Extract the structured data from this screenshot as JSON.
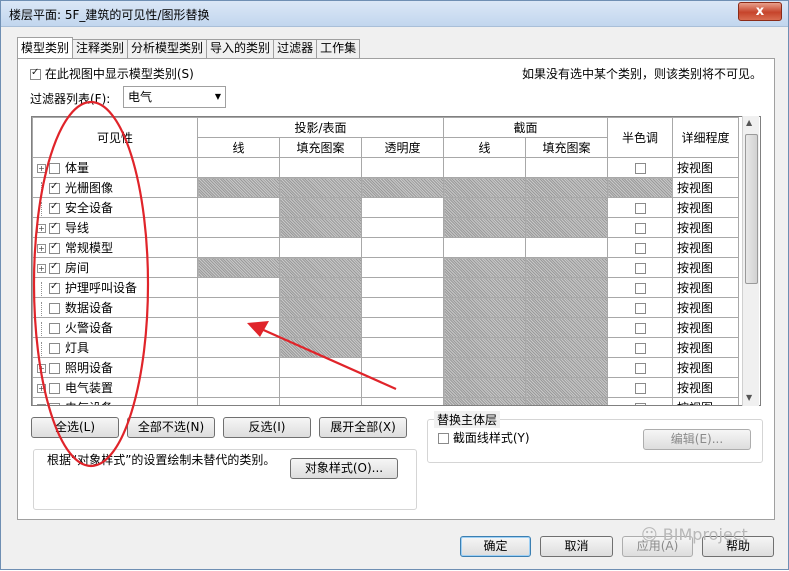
{
  "window": {
    "title": "楼层平面: 5F_建筑的可见性/图形替换",
    "close_symbol": "x"
  },
  "tabs": [
    {
      "label": "模型类别",
      "active": true
    },
    {
      "label": "注释类别",
      "active": false
    },
    {
      "label": "分析模型类别",
      "active": false
    },
    {
      "label": "导入的类别",
      "active": false
    },
    {
      "label": "过滤器",
      "active": false
    },
    {
      "label": "工作集",
      "active": false
    }
  ],
  "panel": {
    "show_categories_label": "在此视图中显示模型类别(S)",
    "show_categories_checked": true,
    "note": "如果没有选中某个类别，则该类别将不可见。",
    "filter_list_label": "过滤器列表(F):",
    "filter_list_value": "电气"
  },
  "grid": {
    "headers": {
      "visibility": "可见性",
      "projection_surface": "投影/表面",
      "section": "截面",
      "halftone": "半色调",
      "detail_level": "详细程度",
      "lines": "线",
      "fill_pattern": "填充图案",
      "transparency": "透明度",
      "section_lines": "线",
      "section_fill": "填充图案"
    },
    "rows": [
      {
        "name": "体量",
        "expandable": true,
        "checked": false,
        "detail": "按视图",
        "halftone_box": true,
        "hatch": [
          false,
          false,
          false,
          false,
          false
        ]
      },
      {
        "name": "光栅图像",
        "expandable": false,
        "checked": true,
        "detail": "按视图",
        "halftone_box": false,
        "hatch": [
          true,
          true,
          true,
          true,
          true
        ]
      },
      {
        "name": "安全设备",
        "expandable": false,
        "checked": true,
        "detail": "按视图",
        "halftone_box": true,
        "hatch": [
          false,
          true,
          false,
          true,
          true
        ]
      },
      {
        "name": "导线",
        "expandable": true,
        "checked": true,
        "detail": "按视图",
        "halftone_box": true,
        "hatch": [
          false,
          true,
          false,
          true,
          true
        ]
      },
      {
        "name": "常规模型",
        "expandable": true,
        "checked": true,
        "detail": "按视图",
        "halftone_box": true,
        "hatch": [
          false,
          false,
          false,
          false,
          false
        ]
      },
      {
        "name": "房间",
        "expandable": true,
        "checked": true,
        "detail": "按视图",
        "halftone_box": true,
        "hatch": [
          true,
          true,
          false,
          true,
          true
        ]
      },
      {
        "name": "护理呼叫设备",
        "expandable": false,
        "checked": true,
        "detail": "按视图",
        "halftone_box": true,
        "hatch": [
          false,
          true,
          false,
          true,
          true
        ]
      },
      {
        "name": "数据设备",
        "expandable": false,
        "checked": false,
        "detail": "按视图",
        "halftone_box": true,
        "hatch": [
          false,
          true,
          false,
          true,
          true
        ]
      },
      {
        "name": "火警设备",
        "expandable": false,
        "checked": false,
        "detail": "按视图",
        "halftone_box": true,
        "hatch": [
          false,
          true,
          false,
          true,
          true
        ]
      },
      {
        "name": "灯具",
        "expandable": false,
        "checked": false,
        "detail": "按视图",
        "halftone_box": true,
        "hatch": [
          false,
          true,
          false,
          true,
          true
        ]
      },
      {
        "name": "照明设备",
        "expandable": true,
        "checked": false,
        "detail": "按视图",
        "halftone_box": true,
        "hatch": [
          false,
          false,
          false,
          true,
          true
        ]
      },
      {
        "name": "电气装置",
        "expandable": true,
        "checked": false,
        "detail": "按视图",
        "halftone_box": true,
        "hatch": [
          false,
          false,
          false,
          true,
          true
        ]
      },
      {
        "name": "电气设备",
        "expandable": true,
        "checked": false,
        "detail": "按视图",
        "halftone_box": true,
        "hatch": [
          false,
          false,
          false,
          true,
          true
        ]
      }
    ]
  },
  "buttons": {
    "select_all": "全选(L)",
    "select_none": "全部不选(N)",
    "invert": "反选(I)",
    "expand_all": "展开全部(X)",
    "object_styles": "对象样式(O)...",
    "edit": "编辑(E)...",
    "ok": "确定",
    "cancel": "取消",
    "apply": "应用(A)",
    "help": "帮助"
  },
  "override_host": {
    "legend": "替换主体层",
    "cut_line_styles": "截面线样式(Y)",
    "cut_line_checked": false
  },
  "object_styles_note": "根据“对象样式”的设置绘制未替代的类别。",
  "watermark": "BIMproject",
  "colors": {
    "annotation_red": "#e0242a",
    "title_bar": "#c8daf0",
    "close_button": "#c6442b"
  }
}
